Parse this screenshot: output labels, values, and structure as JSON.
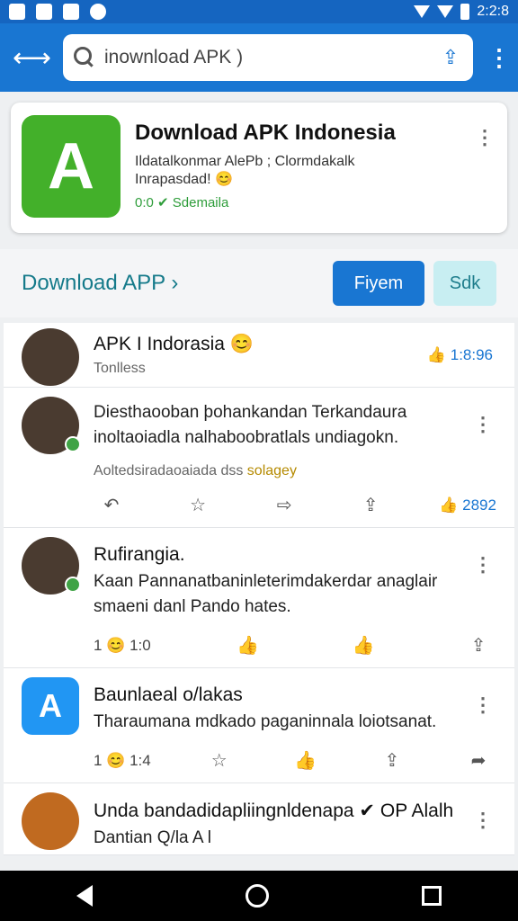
{
  "status": {
    "time": "2:2:8"
  },
  "search": {
    "text": "inownload APK )"
  },
  "hero": {
    "title": "Download APK Indonesia",
    "subtitle": "Ildatalkonmar AlePb ; Clormdakalk Inrapasdad! 😊",
    "meta": "0:0 ✔ Sdemaila"
  },
  "section": {
    "title": "Download APP ›",
    "btn_primary": "Fiyem",
    "btn_secondary": "Sdk"
  },
  "posts": [
    {
      "title": "APK I Indorasia 😊",
      "sub": "Tonlless",
      "likes": "1:8:96"
    },
    {
      "text": "Diesthaooban þohankandan Terkandaura inoltaoiadla nalhaboobratlals undiagokn.",
      "sub_a": "Aoltedsiradaoaiada dss",
      "sub_b": "solagey",
      "count": "2892"
    },
    {
      "title": "Rufirangia.",
      "text": "Kaan Pannanatbaninleterimdakerdar anaglair smaeni danl Pando hates.",
      "r1": "1 😊 1:0"
    },
    {
      "title": "Baunlaeal o/lakas",
      "text": "Tharaumana mdkado paganinnala loiotsanat.",
      "r1": "1 😊 1:4"
    },
    {
      "title": "Unda bandadidapliingnldenapa ✔ OP Alalh",
      "text": "Dantian Q/la A l"
    }
  ]
}
